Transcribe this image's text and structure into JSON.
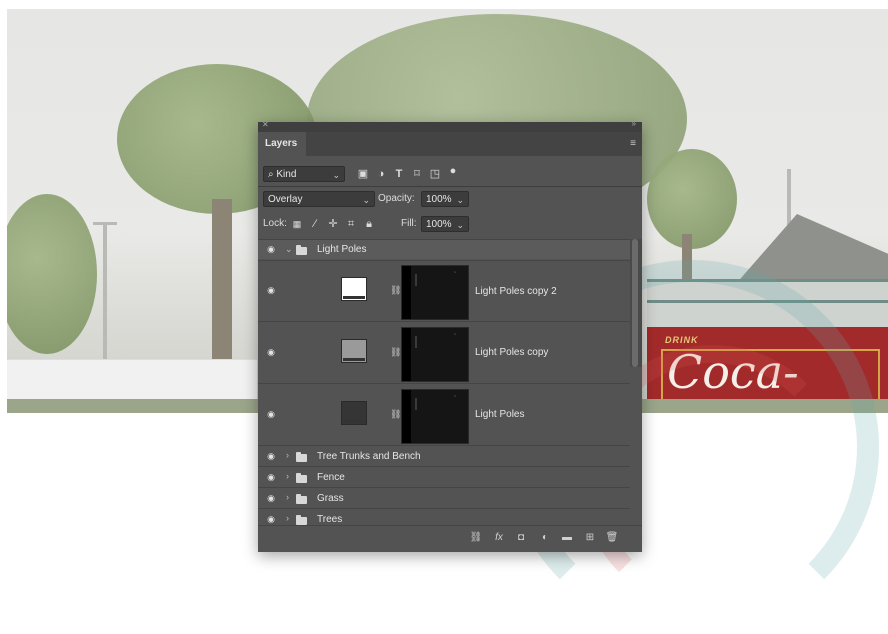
{
  "panel": {
    "tab_title": "Layers",
    "menu_icon": "hamburger-icon",
    "filter": {
      "kind_label": "Kind",
      "search_icon": "search-icon"
    },
    "blend": {
      "mode": "Overlay",
      "opacity_label": "Opacity:",
      "opacity_value": "100%"
    },
    "lock": {
      "label": "Lock:",
      "fill_label": "Fill:",
      "fill_value": "100%"
    },
    "group": {
      "name": "Light Poles"
    },
    "layers": [
      {
        "name": "Light Poles copy 2",
        "thumb_color": "#ffffff"
      },
      {
        "name": "Light Poles copy",
        "thumb_color": "#9a9a9a"
      },
      {
        "name": "Light Poles",
        "thumb_color": "#353535"
      }
    ],
    "folders": [
      {
        "name": "Tree Trunks and Bench"
      },
      {
        "name": "Fence"
      },
      {
        "name": "Grass"
      },
      {
        "name": "Trees"
      }
    ]
  },
  "photo": {
    "sign_top": "DRINK",
    "sign_logo": "Coca-Cola"
  },
  "colors": {
    "panel_bg": "#535353",
    "panel_dark": "#3c3c3c",
    "sign_red": "#a32a2a"
  }
}
